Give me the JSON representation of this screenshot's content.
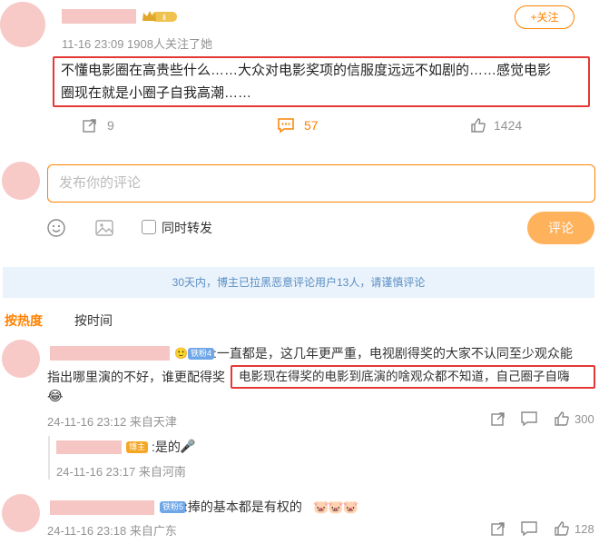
{
  "post": {
    "meta": "11-16 23:09 1908人关注了她",
    "follow_label": "+关注",
    "text_line1": "不懂电影圈在高贵些什么……大众对电影奖项的信服度远远不如剧的……感觉电影",
    "text_line2": "圈现在就是小圈子自我高潮……",
    "repost_count": "9",
    "comment_count": "57",
    "like_count": "1424"
  },
  "composer": {
    "placeholder": "发布你的评论",
    "repost_label": "同时转发",
    "submit_label": "评论"
  },
  "notice": "30天内，博主已拉黑恶意评论用户13人，请谨慎评论",
  "sort": {
    "hot_label": "按热度",
    "time_label": "按时间"
  },
  "comments": [
    {
      "badge": "铁粉4",
      "text_line1": ":一直都是，这几年更严重，电视剧得奖的大家不认同至少观众能",
      "text_line2_a": "指出哪里演的不好，谁更配得奖",
      "text_line2_b": "电影现在得奖的电影到底演的啥观众都不知道，自己圈子自嗨",
      "emoji": "😂",
      "meta": "24-11-16 23:12 来自天津",
      "like_count": "300",
      "reply": {
        "badge": "博主",
        "text": ":是的",
        "emoji": "🎤",
        "meta": "24-11-16 23:17 来自河南"
      }
    },
    {
      "badge": "铁粉5",
      "text": ":捧的基本都是有权的",
      "emoji": "🐷🐷🐷",
      "meta": "24-11-16 23:18 来自广东",
      "like_count": "128"
    }
  ]
}
